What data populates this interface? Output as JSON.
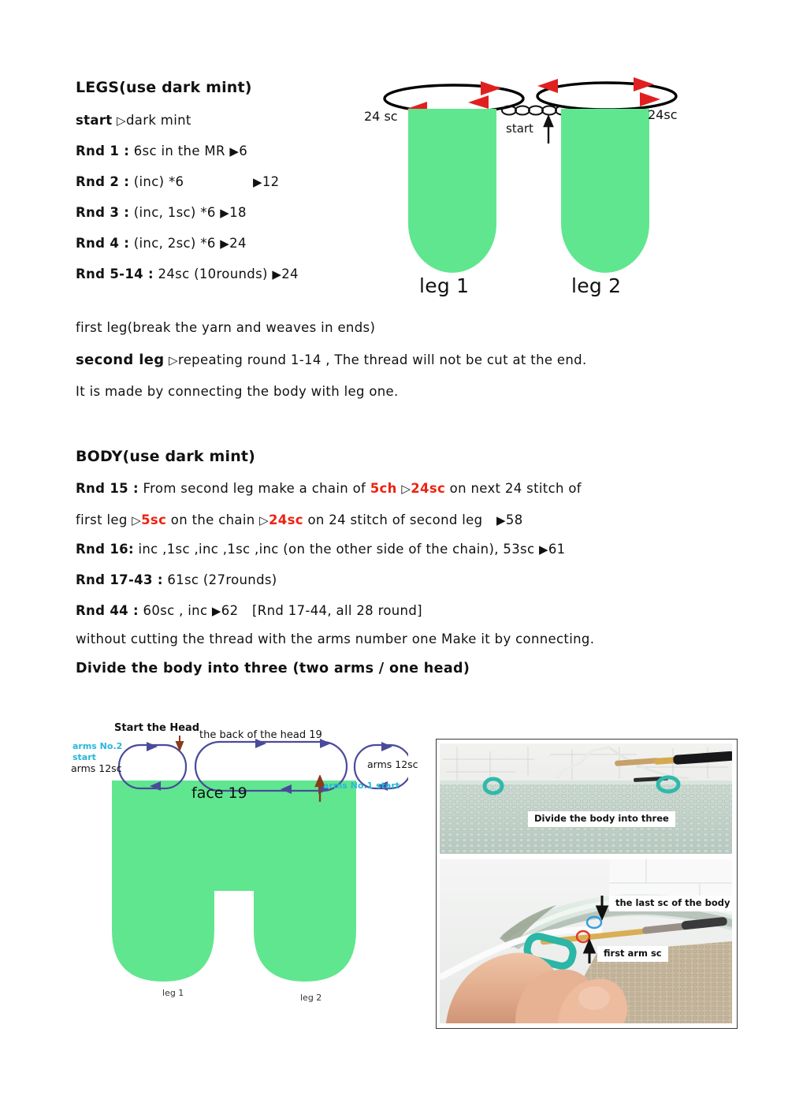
{
  "legs_section": {
    "heading": "LEGS(use dark mint)",
    "rows": [
      {
        "label": "start",
        "marker": "open",
        "text": "dark mint",
        "result": ""
      },
      {
        "label": "Rnd 1 :",
        "marker": "none",
        "text": "6sc in the MR",
        "result": "6"
      },
      {
        "label": "Rnd 2 :",
        "marker": "none",
        "text": "(inc) *6",
        "result": "12"
      },
      {
        "label": "Rnd 3 :",
        "marker": "none",
        "text": "(inc, 1sc) *6",
        "result": "18"
      },
      {
        "label": "Rnd 4 :",
        "marker": "none",
        "text": "(inc, 2sc) *6",
        "result": "24"
      },
      {
        "label": "Rnd 5-14 :",
        "marker": "none",
        "text": "24sc (10rounds)",
        "result": "24"
      }
    ]
  },
  "leg_diagram": {
    "leg1_caption": "leg 1",
    "leg2_caption": "leg 2",
    "leg1_sc_label": "24 sc",
    "leg2_sc_label": "24sc",
    "start_label": "start",
    "shape_color": "#60e68f"
  },
  "notes": {
    "first_leg": "first leg(break the yarn and weaves in ends)",
    "second_leg_label": "second leg",
    "second_leg_text": "repeating round 1-14 , The thread will not be cut at the end.",
    "connect_text": "It is made by connecting the body with leg one."
  },
  "body_section": {
    "heading": "BODY(use dark mint)",
    "rnd15_label": "Rnd 15 :",
    "rnd15_a": "From second leg make a chain of",
    "rnd15_red1": "5ch",
    "rnd15_red2": "24sc",
    "rnd15_b": "on next 24 stitch of",
    "rnd15_c": "first leg",
    "rnd15_red3": "5sc",
    "rnd15_d": "on the chain",
    "rnd15_red4": "24sc",
    "rnd15_e": "on 24 stitch of second leg",
    "rnd15_result": "58",
    "rnd16_label": "Rnd 16:",
    "rnd16_text": "inc ,1sc ,inc ,1sc ,inc (on the other side of the chain), 53sc",
    "rnd16_result": "61",
    "rnd1743_label": "Rnd 17-43 :",
    "rnd1743_text": "61sc (27rounds)",
    "rnd44_label": "Rnd 44 :",
    "rnd44_text": "60sc , inc",
    "rnd44_result": "62",
    "rnd44_bracket": "[Rnd 17-44, all 28 round]",
    "without_cutting": "without cutting the thread with the arms number one Make it by connecting.",
    "divide_body": "Divide the body into three (two arms / one head)"
  },
  "body_diagram": {
    "face_label": "face 19",
    "arms_no2": "arms No.2",
    "start2": "start",
    "arms12sc_left": "arms 12sc",
    "start_the_head": "Start the Head",
    "back_of_head": "the back of the head 19",
    "arms12sc_right": "arms 12sc",
    "arms_no1_start": "arms No.1 start",
    "leg1": "leg 1",
    "leg2": "leg 2",
    "loop_color": "#4a4a9c",
    "cyan_color": "#29b6d8"
  },
  "photos": {
    "top_caption": "Divide the body into three",
    "bottom_caption_1": "the last sc of the body",
    "bottom_caption_2": "first arm sc"
  }
}
